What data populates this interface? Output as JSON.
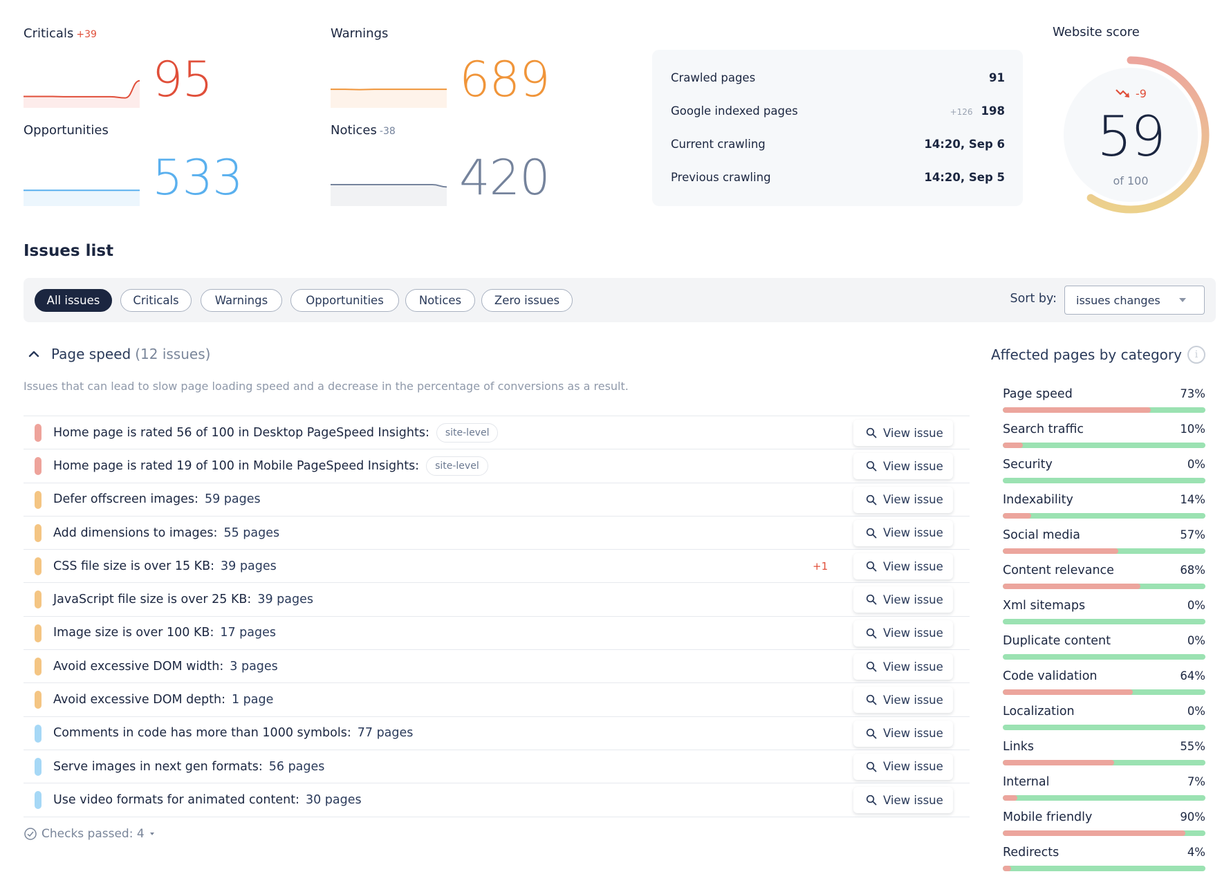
{
  "metrics": {
    "criticals": {
      "label": "Criticals",
      "delta": "+39",
      "value": "95",
      "color": "#e04f3a",
      "fill": "#fdeceb",
      "trend": [
        0.35,
        0.35,
        0.35,
        0.34,
        0.34,
        0.34,
        0.34,
        0.3,
        0.9
      ]
    },
    "warnings": {
      "label": "Warnings",
      "delta": "",
      "value": "689",
      "color": "#f0953a",
      "fill": "#fef3ea",
      "trend": [
        0.6,
        0.6,
        0.59,
        0.6,
        0.6,
        0.6,
        0.6,
        0.6,
        0.6
      ]
    },
    "opportunities": {
      "label": "Opportunities",
      "delta": "",
      "value": "533",
      "color": "#5ab0ee",
      "fill": "#ecf6fd",
      "trend": [
        0.5,
        0.5,
        0.5,
        0.5,
        0.5,
        0.5,
        0.5,
        0.5,
        0.5
      ]
    },
    "notices": {
      "label": "Notices",
      "delta": "-38",
      "value": "420",
      "color": "#75839c",
      "fill": "#f1f2f4",
      "trend": [
        0.7,
        0.7,
        0.7,
        0.7,
        0.7,
        0.7,
        0.7,
        0.7,
        0.62
      ]
    }
  },
  "stats": [
    {
      "label": "Crawled pages",
      "sub": "",
      "value": "91"
    },
    {
      "label": "Google indexed pages",
      "sub": "+126",
      "value": "198"
    },
    {
      "label": "Current crawling",
      "sub": "",
      "value": "14:20, Sep 6"
    },
    {
      "label": "Previous crawling",
      "sub": "",
      "value": "14:20, Sep 5"
    }
  ],
  "score": {
    "title": "Website score",
    "delta": "-9",
    "value": "59",
    "of_label": "of 100",
    "fraction": 0.59,
    "gradient_start": "#eca59d",
    "gradient_end": "#ecd18c"
  },
  "issues": {
    "title": "Issues list",
    "filters": [
      "All issues",
      "Criticals",
      "Warnings",
      "Opportunities",
      "Notices",
      "Zero issues"
    ],
    "active_filter": "All issues",
    "sort_label": "Sort by:",
    "sort_value": "issues changes",
    "group": {
      "name": "Page speed",
      "count": "(12 issues)",
      "description": "Issues that can lead to slow page loading speed and a decrease in the percentage of conversions as a result."
    },
    "view_label": "View issue",
    "rows": [
      {
        "text": "Home page is rated 56 of 100 in Desktop PageSpeed Insights:",
        "pages": "",
        "badge": "site-level",
        "delta": "",
        "severity": "critical"
      },
      {
        "text": "Home page is rated 19 of 100 in Mobile PageSpeed Insights:",
        "pages": "",
        "badge": "site-level",
        "delta": "",
        "severity": "critical"
      },
      {
        "text": "Defer offscreen images:",
        "pages": "59 pages",
        "badge": "",
        "delta": "",
        "severity": "warning"
      },
      {
        "text": "Add dimensions to images:",
        "pages": "55 pages",
        "badge": "",
        "delta": "",
        "severity": "warning"
      },
      {
        "text": "CSS file size is over 15 KB:",
        "pages": "39 pages",
        "badge": "",
        "delta": "+1",
        "severity": "warning"
      },
      {
        "text": "JavaScript file size is over 25 KB:",
        "pages": "39 pages",
        "badge": "",
        "delta": "",
        "severity": "warning"
      },
      {
        "text": "Image size is over 100 KB:",
        "pages": "17 pages",
        "badge": "",
        "delta": "",
        "severity": "warning"
      },
      {
        "text": "Avoid excessive DOM width:",
        "pages": "3 pages",
        "badge": "",
        "delta": "",
        "severity": "warning"
      },
      {
        "text": "Avoid excessive DOM depth:",
        "pages": "1 page",
        "badge": "",
        "delta": "",
        "severity": "warning"
      },
      {
        "text": "Comments in code has more than 1000 symbols:",
        "pages": "77 pages",
        "badge": "",
        "delta": "",
        "severity": "opportunity"
      },
      {
        "text": "Serve images in next gen formats:",
        "pages": "56 pages",
        "badge": "",
        "delta": "",
        "severity": "opportunity"
      },
      {
        "text": "Use video formats for animated content:",
        "pages": "30 pages",
        "badge": "",
        "delta": "",
        "severity": "opportunity"
      }
    ],
    "severity_colors": {
      "critical": "#eea39b",
      "warning": "#f4c583",
      "opportunity": "#a6d8f6"
    },
    "checks_passed": "Checks passed: 4"
  },
  "categories": {
    "title": "Affected pages by category",
    "info_icon": "info-icon",
    "items": [
      {
        "name": "Page speed",
        "percent": 73
      },
      {
        "name": "Search traffic",
        "percent": 10
      },
      {
        "name": "Security",
        "percent": 0
      },
      {
        "name": "Indexability",
        "percent": 14
      },
      {
        "name": "Social media",
        "percent": 57
      },
      {
        "name": "Content relevance",
        "percent": 68
      },
      {
        "name": "Xml sitemaps",
        "percent": 0
      },
      {
        "name": "Duplicate content",
        "percent": 0
      },
      {
        "name": "Code validation",
        "percent": 64
      },
      {
        "name": "Localization",
        "percent": 0
      },
      {
        "name": "Links",
        "percent": 55
      },
      {
        "name": "Internal",
        "percent": 7
      },
      {
        "name": "Mobile friendly",
        "percent": 90
      },
      {
        "name": "Redirects",
        "percent": 4
      }
    ]
  }
}
